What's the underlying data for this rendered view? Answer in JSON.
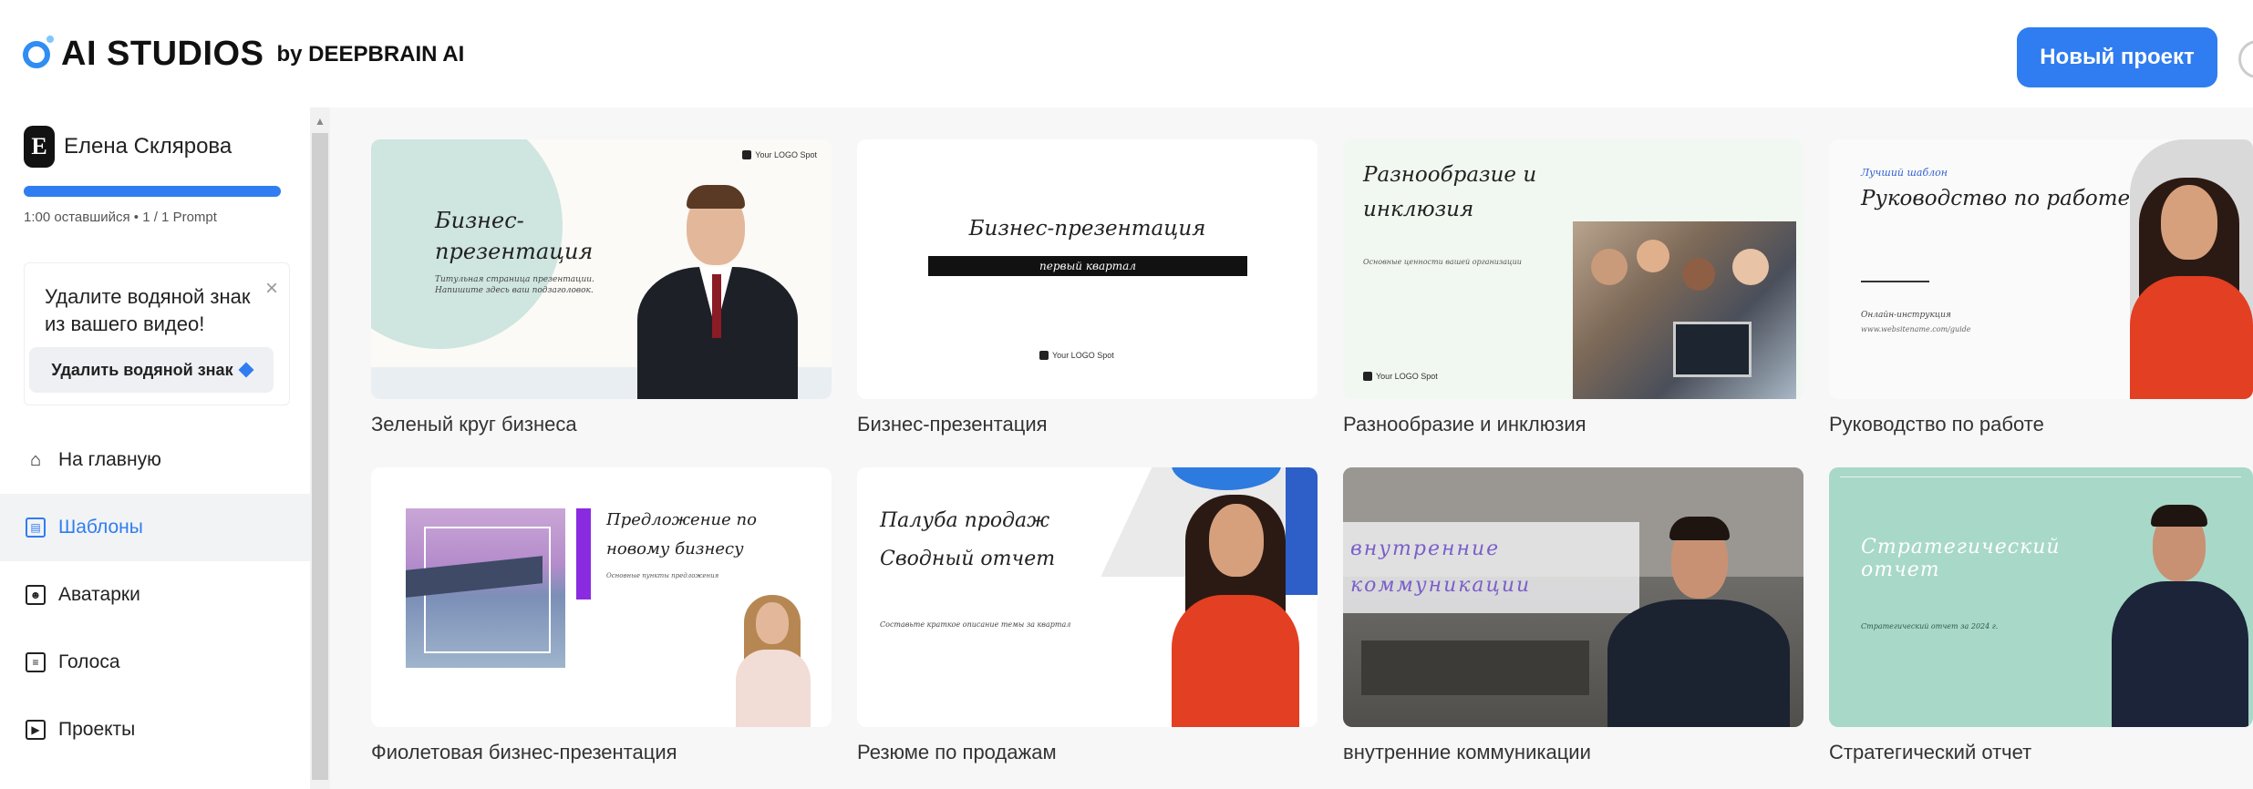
{
  "header": {
    "brand_name": "AI STUDIOS",
    "brand_by": "by DEEPBRAIN AI",
    "new_project_label": "Новый проект"
  },
  "sidebar": {
    "user_initial": "E",
    "user_name": "Елена Склярова",
    "quota_text": "1:00 оставшийся • 1 / 1 Prompt",
    "quota_fraction": 1.0,
    "promo_text": "Удалите водяной знак из вашего видео!",
    "promo_button": "Удалить водяной знак",
    "nav": [
      {
        "label": "На главную",
        "icon": "home-icon"
      },
      {
        "label": "Шаблоны",
        "icon": "templates-icon"
      },
      {
        "label": "Аватарки",
        "icon": "avatar-icon"
      },
      {
        "label": "Голоса",
        "icon": "voice-icon"
      },
      {
        "label": "Проекты",
        "icon": "projects-icon"
      }
    ]
  },
  "templates": [
    {
      "name": "Зеленый круг бизнеса",
      "title": "Бизнес-презентация",
      "subtitle": "Титульная страница презентации. Напишите здесь ваш подзаголовок.",
      "logo": "Your LOGO Spot"
    },
    {
      "name": "Бизнес-презентация",
      "title": "Бизнес-презентация",
      "subtitle": "первый квартал",
      "logo": "Your LOGO Spot"
    },
    {
      "name": "Разнообразие и инклюзия",
      "title": "Разнообразие и инклюзия",
      "subtitle": "Основные ценности вашей организации",
      "logo": "Your LOGO Spot"
    },
    {
      "name": "Руководство по работе",
      "title": "Руководство по работе",
      "tag": "Лучший шаблон",
      "subtitle": "Онлайн-инструкция",
      "url": "www.websitename.com/guide"
    },
    {
      "name": "Фиолетовая бизнес-презентация",
      "title": "Предложение по новому бизнесу",
      "subtitle": "Основные пункты предложения"
    },
    {
      "name": "Резюме по продажам",
      "title": "Палуба продаж Сводный отчет",
      "subtitle": "Составьте краткое описание темы за квартал"
    },
    {
      "name": "внутренние коммуникации",
      "title": "внутренние коммуникации"
    },
    {
      "name": "Стратегический отчет",
      "title": "Стратегический отчет",
      "subtitle": "Стратегический отчет за 2024 г."
    }
  ]
}
